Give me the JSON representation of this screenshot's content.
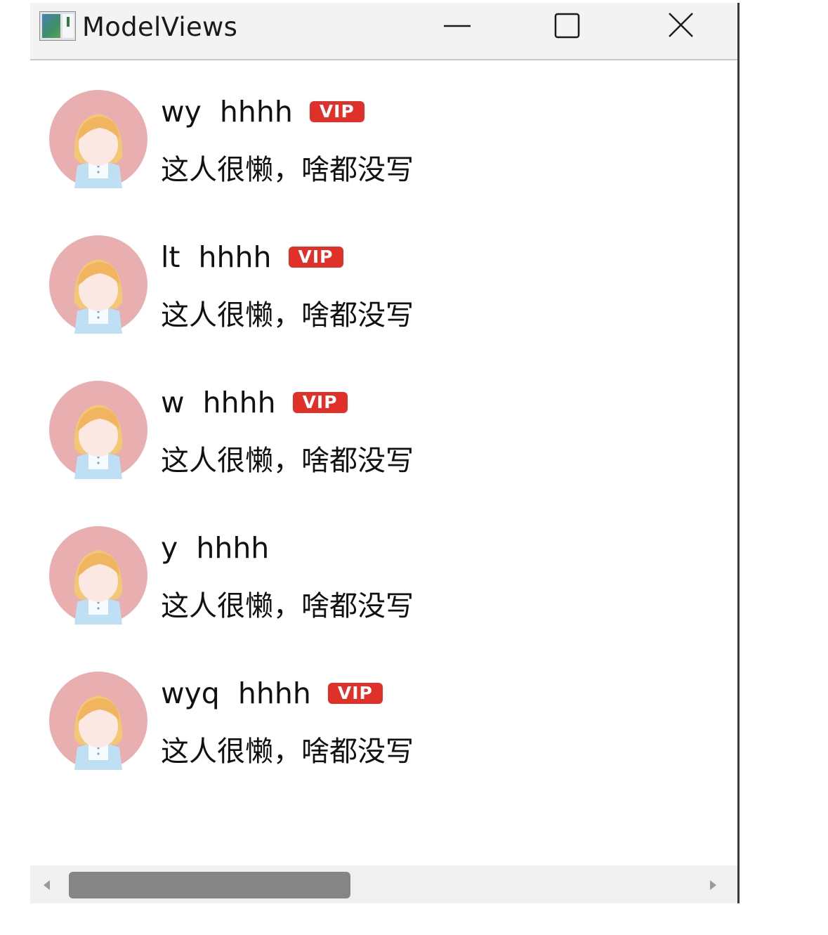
{
  "window": {
    "title": "ModelViews",
    "app_icon": "qt-app-window-icon",
    "controls": {
      "minimize_icon": "minimize-icon",
      "maximize_icon": "maximize-icon",
      "close_icon": "close-icon"
    }
  },
  "contacts": [
    {
      "username": "wy",
      "nickname": "hhhh",
      "vip": true,
      "vip_label": "VIP",
      "signature": "这人很懒，啥都没写",
      "avatar": "avatar-girl-icon"
    },
    {
      "username": "lt",
      "nickname": "hhhh",
      "vip": true,
      "vip_label": "VIP",
      "signature": "这人很懒，啥都没写",
      "avatar": "avatar-girl-icon"
    },
    {
      "username": "w",
      "nickname": "hhhh",
      "vip": true,
      "vip_label": "VIP",
      "signature": "这人很懒，啥都没写",
      "avatar": "avatar-girl-icon"
    },
    {
      "username": "y",
      "nickname": "hhhh",
      "vip": false,
      "vip_label": "",
      "signature": "这人很懒，啥都没写",
      "avatar": "avatar-girl-icon"
    },
    {
      "username": "wyq",
      "nickname": "hhhh",
      "vip": true,
      "vip_label": "VIP",
      "signature": "这人很懒，啥都没写",
      "avatar": "avatar-girl-icon"
    }
  ],
  "scrollbar": {
    "orientation": "horizontal",
    "left_arrow_icon": "scroll-left-arrow-icon",
    "right_arrow_icon": "scroll-right-arrow-icon"
  },
  "colors": {
    "vip_badge": "#e0302a",
    "avatar_bg": "#e9aeb0",
    "titlebar": "#f3f3f3",
    "scroll_thumb": "#858585"
  }
}
